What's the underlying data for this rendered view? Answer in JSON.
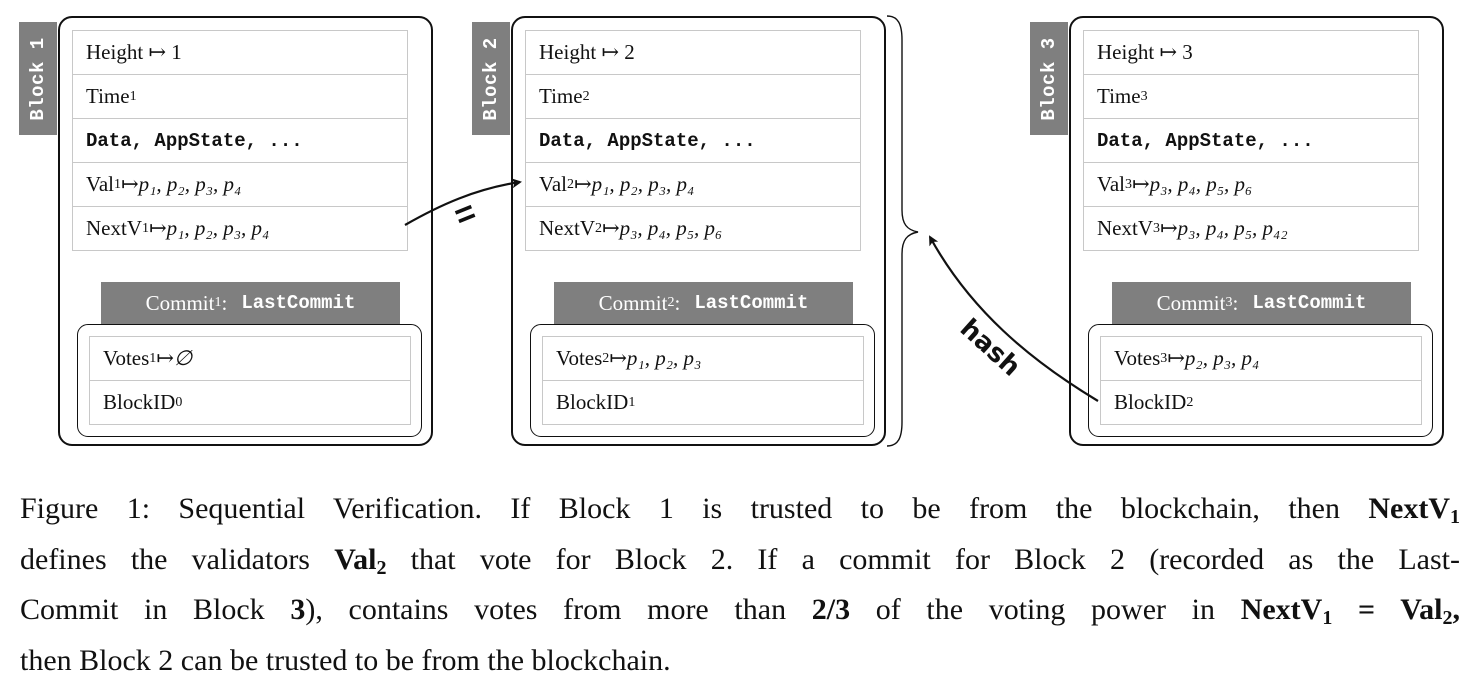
{
  "blocks": [
    {
      "label": "Block 1",
      "fields": {
        "height_label": "Height ↦ 1",
        "time_label": "Time",
        "time_sub": "1",
        "data_label": "Data, AppState, ...",
        "val_label": "Val",
        "val_sub": "1",
        "val_value": "p₁, p₂, p₃, p₄",
        "nextv_label": "NextV",
        "nextv_sub": "1",
        "nextv_value": "p₁, p₂, p₃, p₄"
      },
      "commit": {
        "label": "Commit",
        "sub": "1",
        "colon": ":",
        "type": "LastCommit",
        "votes_label": "Votes",
        "votes_sub": "1",
        "votes_value": "∅",
        "blockid_label": "BlockID",
        "blockid_sub": "0"
      }
    },
    {
      "label": "Block 2",
      "fields": {
        "height_label": "Height ↦ 2",
        "time_label": "Time",
        "time_sub": "2",
        "data_label": "Data, AppState, ...",
        "val_label": "Val",
        "val_sub": "2",
        "val_value": "p₁, p₂, p₃, p₄",
        "nextv_label": "NextV",
        "nextv_sub": "2",
        "nextv_value": "p₃, p₄, p₅, p₆"
      },
      "commit": {
        "label": "Commit",
        "sub": "2",
        "colon": ":",
        "type": "LastCommit",
        "votes_label": "Votes",
        "votes_sub": "2",
        "votes_value": "p₁, p₂, p₃",
        "blockid_label": "BlockID",
        "blockid_sub": "1"
      }
    },
    {
      "label": "Block 3",
      "fields": {
        "height_label": "Height ↦ 3",
        "time_label": "Time",
        "time_sub": "3",
        "data_label": "Data, AppState, ...",
        "val_label": "Val",
        "val_sub": "3",
        "val_value": "p₃, p₄, p₅, p₆",
        "nextv_label": "NextV",
        "nextv_sub": "3",
        "nextv_value": "p₃, p₄, p₅, p₄₂"
      },
      "commit": {
        "label": "Commit",
        "sub": "3",
        "colon": ":",
        "type": "LastCommit",
        "votes_label": "Votes",
        "votes_sub": "3",
        "votes_value": "p₂, p₃, p₄",
        "blockid_label": "BlockID",
        "blockid_sub": "2"
      }
    }
  ],
  "mapsto": " ↦ ",
  "connectors": {
    "equals_label": "=",
    "hash_label": "hash"
  },
  "caption": {
    "l1_a": "Figure 1: Sequential Verification. If Block 1 is trusted to be from the blockchain, then ",
    "l1_b": "NextV",
    "l1_b_sub": "1",
    "l2_a": "defines the validators ",
    "l2_b": "Val",
    "l2_b_sub": "2",
    "l2_c": " that vote for Block 2. If a commit for Block 2 (recorded as the Last-",
    "l3_a": "Commit in Block ",
    "l3_b": "3",
    "l3_c": "), contains votes from more than ",
    "l3_d": "2/3",
    "l3_e": " of the voting power in ",
    "l3_f": "NextV",
    "l3_f_sub": "1",
    "l3_g": " = ",
    "l3_h": "Val",
    "l3_h_sub": "2",
    "l3_i": ",",
    "l4": "then Block 2 can be trusted to be from the blockchain."
  }
}
